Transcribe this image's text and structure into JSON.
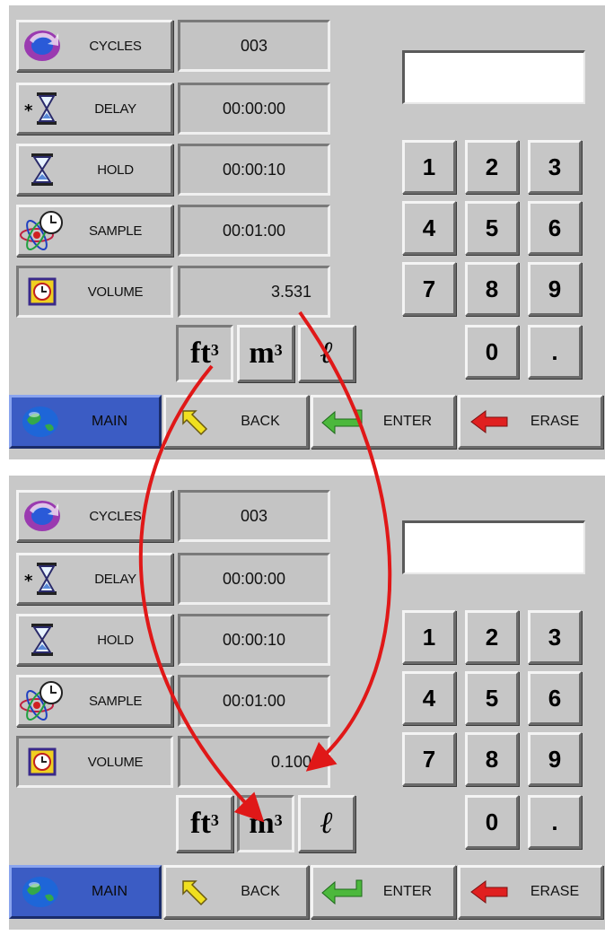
{
  "screens": [
    {
      "params": [
        {
          "label": "CYCLES",
          "value": "003",
          "icon": "cycle-arrows-icon"
        },
        {
          "label": "DELAY",
          "value": "00:00:00",
          "icon": "hourglass-star-icon"
        },
        {
          "label": "HOLD",
          "value": "00:00:10",
          "icon": "hourglass-icon"
        },
        {
          "label": "SAMPLE",
          "value": "00:01:00",
          "icon": "atom-clock-icon"
        },
        {
          "label": "VOLUME",
          "value": "3.531",
          "icon": "clock-cube-icon"
        }
      ],
      "display_value": "",
      "active_unit": "ft3"
    },
    {
      "params": [
        {
          "label": "CYCLES",
          "value": "003",
          "icon": "cycle-arrows-icon"
        },
        {
          "label": "DELAY",
          "value": "00:00:00",
          "icon": "hourglass-star-icon"
        },
        {
          "label": "HOLD",
          "value": "00:00:10",
          "icon": "hourglass-icon"
        },
        {
          "label": "SAMPLE",
          "value": "00:01:00",
          "icon": "atom-clock-icon"
        },
        {
          "label": "VOLUME",
          "value": "0.100",
          "icon": "clock-cube-icon"
        }
      ],
      "display_value": "",
      "active_unit": "m3"
    }
  ],
  "keypad": [
    "1",
    "2",
    "3",
    "4",
    "5",
    "6",
    "7",
    "8",
    "9",
    "0",
    "."
  ],
  "units": {
    "ft3_base": "ft",
    "ft3_sup": "3",
    "m3_base": "m",
    "m3_sup": "3",
    "litre": "ℓ"
  },
  "nav": {
    "main": "MAIN",
    "back": "BACK",
    "enter": "ENTER",
    "erase": "ERASE"
  },
  "colors": {
    "panel": "#c8c8c8",
    "main_button": "#3b5cc4",
    "annotation_arrow": "#e01818",
    "enter_arrow": "#4cb83c",
    "erase_arrow": "#e02020",
    "back_arrow": "#f0e020"
  }
}
